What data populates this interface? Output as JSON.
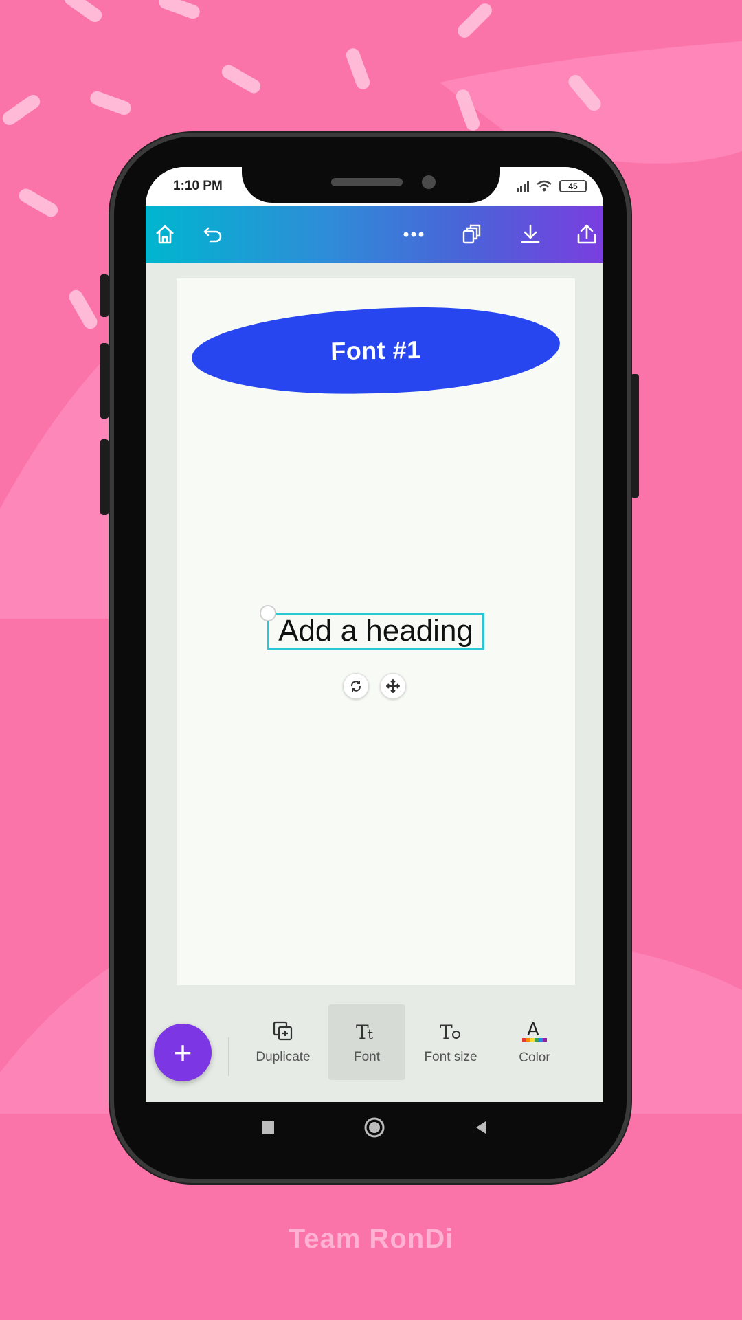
{
  "colors": {
    "background": "#fb74a9",
    "toolbar_gradient_start": "#00b6cf",
    "toolbar_gradient_end": "#7a3ee0",
    "blob": "#2746f0",
    "fab": "#7d36e3",
    "selection": "#29c7d6"
  },
  "status_bar": {
    "time": "1:10 PM",
    "battery": "45"
  },
  "toolbar": {
    "icons": [
      "home-icon",
      "undo-icon",
      "more-icon",
      "pages-icon",
      "download-icon",
      "share-icon"
    ]
  },
  "canvas": {
    "blob_text": "Font #1",
    "heading_text": "Add a heading",
    "controls": [
      "rotate-icon",
      "move-icon"
    ]
  },
  "bottom_toolbar": {
    "fab_label": "+",
    "tools": [
      {
        "label": "Duplicate",
        "icon": "duplicate-icon"
      },
      {
        "label": "Font",
        "icon": "font-icon",
        "active": true
      },
      {
        "label": "Font size",
        "icon": "font-size-icon"
      },
      {
        "label": "Color",
        "icon": "text-color-icon"
      }
    ]
  },
  "android_nav": [
    "recents-icon",
    "home-circle-icon",
    "back-icon"
  ],
  "footer": {
    "brand": "Team RonDi"
  }
}
